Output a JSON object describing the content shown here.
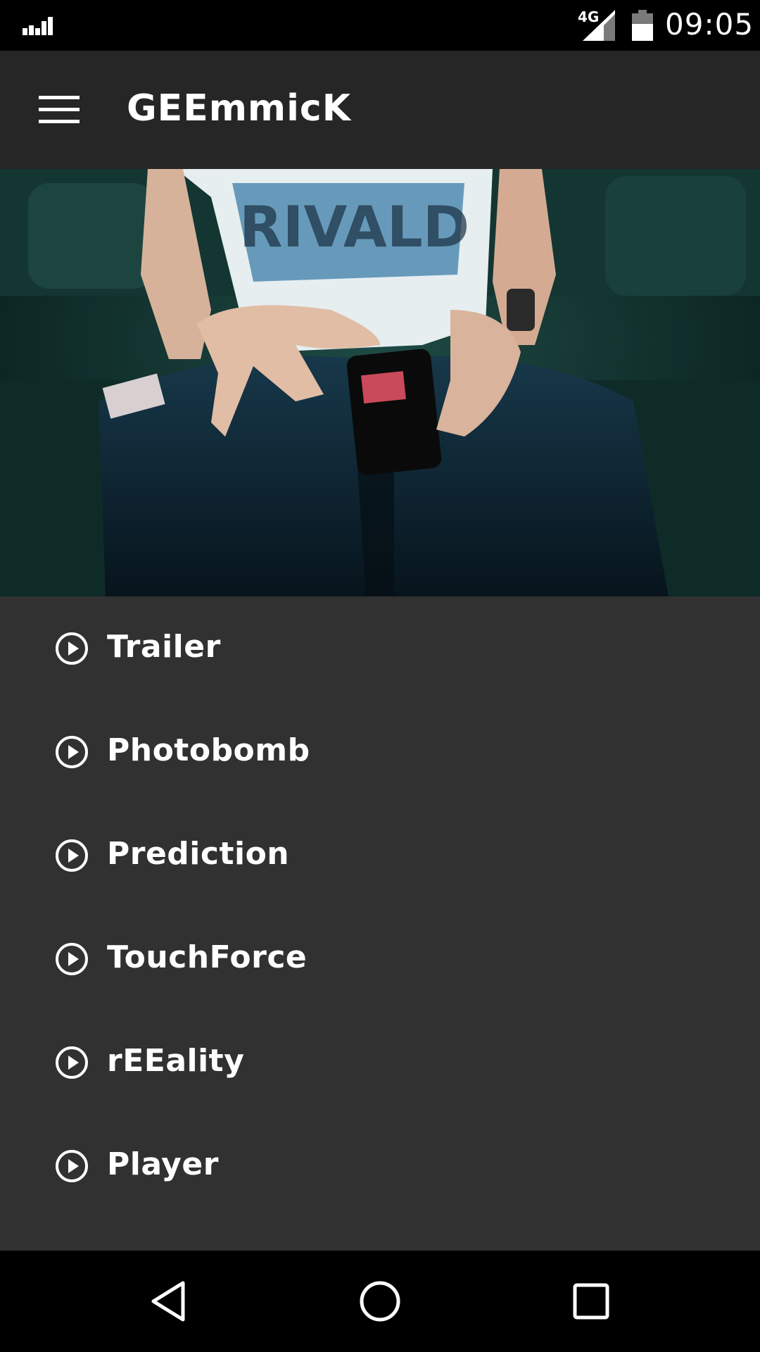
{
  "status_bar": {
    "network": "4G",
    "time": "09:05"
  },
  "app_bar": {
    "title": "GEEmmicK",
    "menu_icon": "hamburger-menu-icon"
  },
  "hero": {
    "description_icon": "hero-image"
  },
  "menu": {
    "items": [
      {
        "label": "Trailer",
        "icon": "play-circle-icon"
      },
      {
        "label": "Photobomb",
        "icon": "play-circle-icon"
      },
      {
        "label": "Prediction",
        "icon": "play-circle-icon"
      },
      {
        "label": "TouchForce",
        "icon": "play-circle-icon"
      },
      {
        "label": "rEEality",
        "icon": "play-circle-icon"
      },
      {
        "label": "Player",
        "icon": "play-circle-icon"
      }
    ]
  },
  "nav_bar": {
    "back_icon": "back-icon",
    "home_icon": "home-icon",
    "recents_icon": "recents-icon"
  },
  "colors": {
    "background": "#313131",
    "app_bar": "#262626",
    "text": "#ffffff"
  }
}
